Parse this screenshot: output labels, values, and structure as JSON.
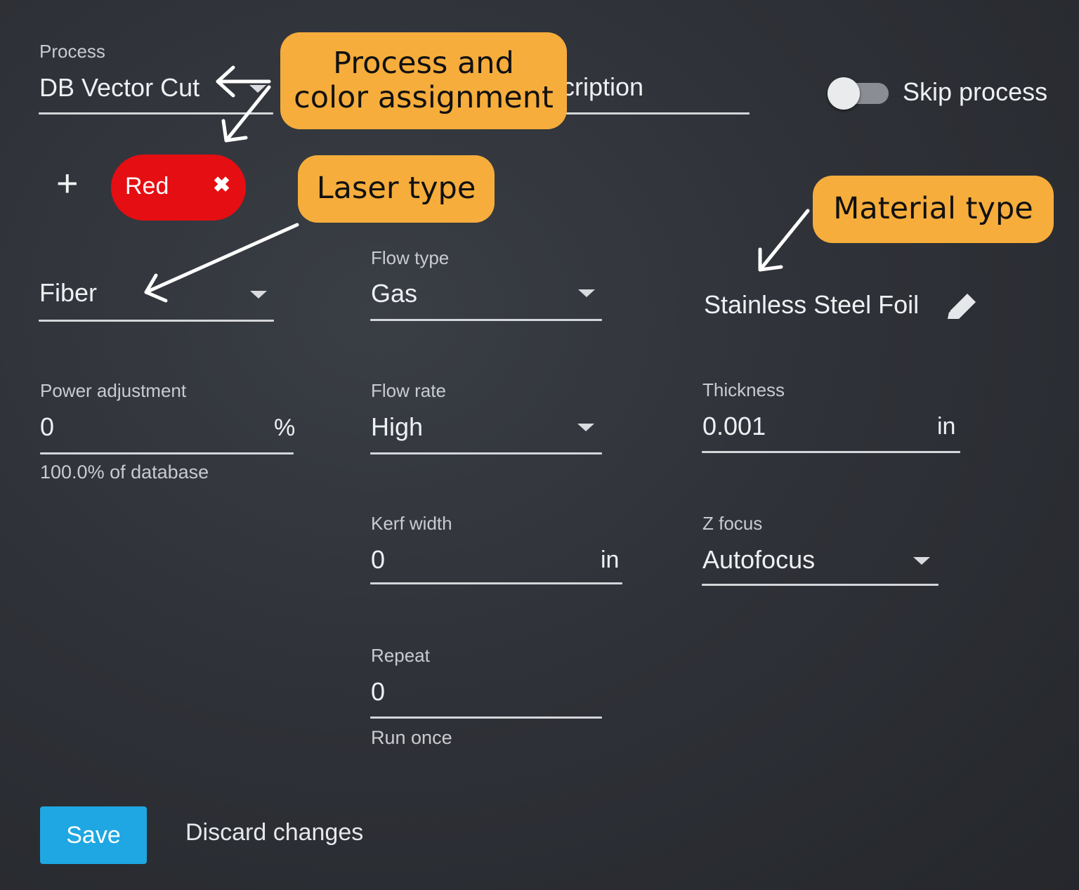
{
  "process": {
    "label": "Process",
    "value": "DB Vector Cut",
    "description_partial": "cription"
  },
  "skip_process": {
    "label": "Skip process",
    "checked": false
  },
  "color_assignment": {
    "add_symbol": "+",
    "chip_label": "Red",
    "chip_remove": "✖",
    "chip_color": "#e50e12"
  },
  "laser_type": {
    "value": "Fiber"
  },
  "flow_type": {
    "label": "Flow type",
    "value": "Gas"
  },
  "material": {
    "value": "Stainless Steel Foil"
  },
  "power_adjustment": {
    "label": "Power adjustment",
    "value": "0",
    "unit": "%",
    "helper": "100.0% of database"
  },
  "flow_rate": {
    "label": "Flow rate",
    "value": "High"
  },
  "thickness": {
    "label": "Thickness",
    "value": "0.001",
    "unit": "in"
  },
  "kerf_width": {
    "label": "Kerf width",
    "value": "0",
    "unit": "in"
  },
  "z_focus": {
    "label": "Z focus",
    "value": "Autofocus"
  },
  "repeat": {
    "label": "Repeat",
    "value": "0",
    "helper": "Run once"
  },
  "actions": {
    "save_label": "Save",
    "discard_label": "Discard changes",
    "save_color": "#1ea7e2"
  },
  "annotations": {
    "process_color": "Process and color assignment",
    "process_color_line1": "Process and",
    "process_color_line2": "color assignment",
    "laser_type": "Laser type",
    "material_type": "Material type",
    "callout_color": "#f6ad3c"
  },
  "icons": {
    "edit": "pencil-icon",
    "dropdown": "caret-down-icon",
    "add": "plus-icon",
    "remove": "close-icon"
  }
}
